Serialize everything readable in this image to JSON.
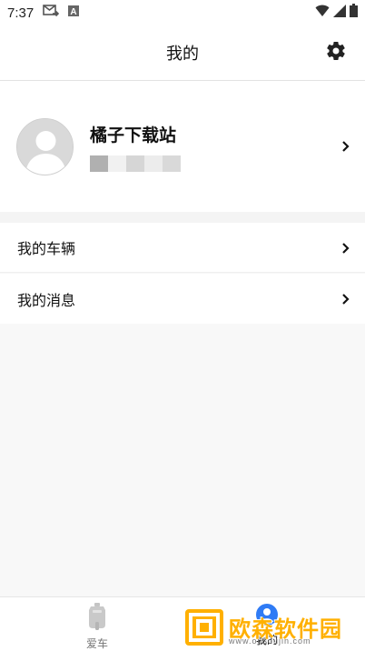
{
  "status_bar": {
    "time": "7:37",
    "icons": [
      "mail-forward-icon",
      "a-box-icon",
      "wifi-icon",
      "signal-icon",
      "battery-icon"
    ]
  },
  "header": {
    "title": "我的",
    "settings_icon": "gear-icon"
  },
  "profile": {
    "name": "橘子下载站",
    "avatar_icon": "default-user-avatar"
  },
  "menu": {
    "items": [
      {
        "label": "我的车辆"
      },
      {
        "label": "我的消息"
      }
    ]
  },
  "bottom_nav": {
    "items": [
      {
        "label": "爱车",
        "icon": "scooter-icon",
        "active": false
      },
      {
        "label": "我的",
        "icon": "person-icon",
        "active": true
      }
    ]
  },
  "watermark": {
    "text": "欧森软件园",
    "url": "www.ousoujin.com"
  },
  "colors": {
    "accent": "#2f7bf5",
    "watermark": "#ffb000",
    "background": "#f7f7f7"
  }
}
